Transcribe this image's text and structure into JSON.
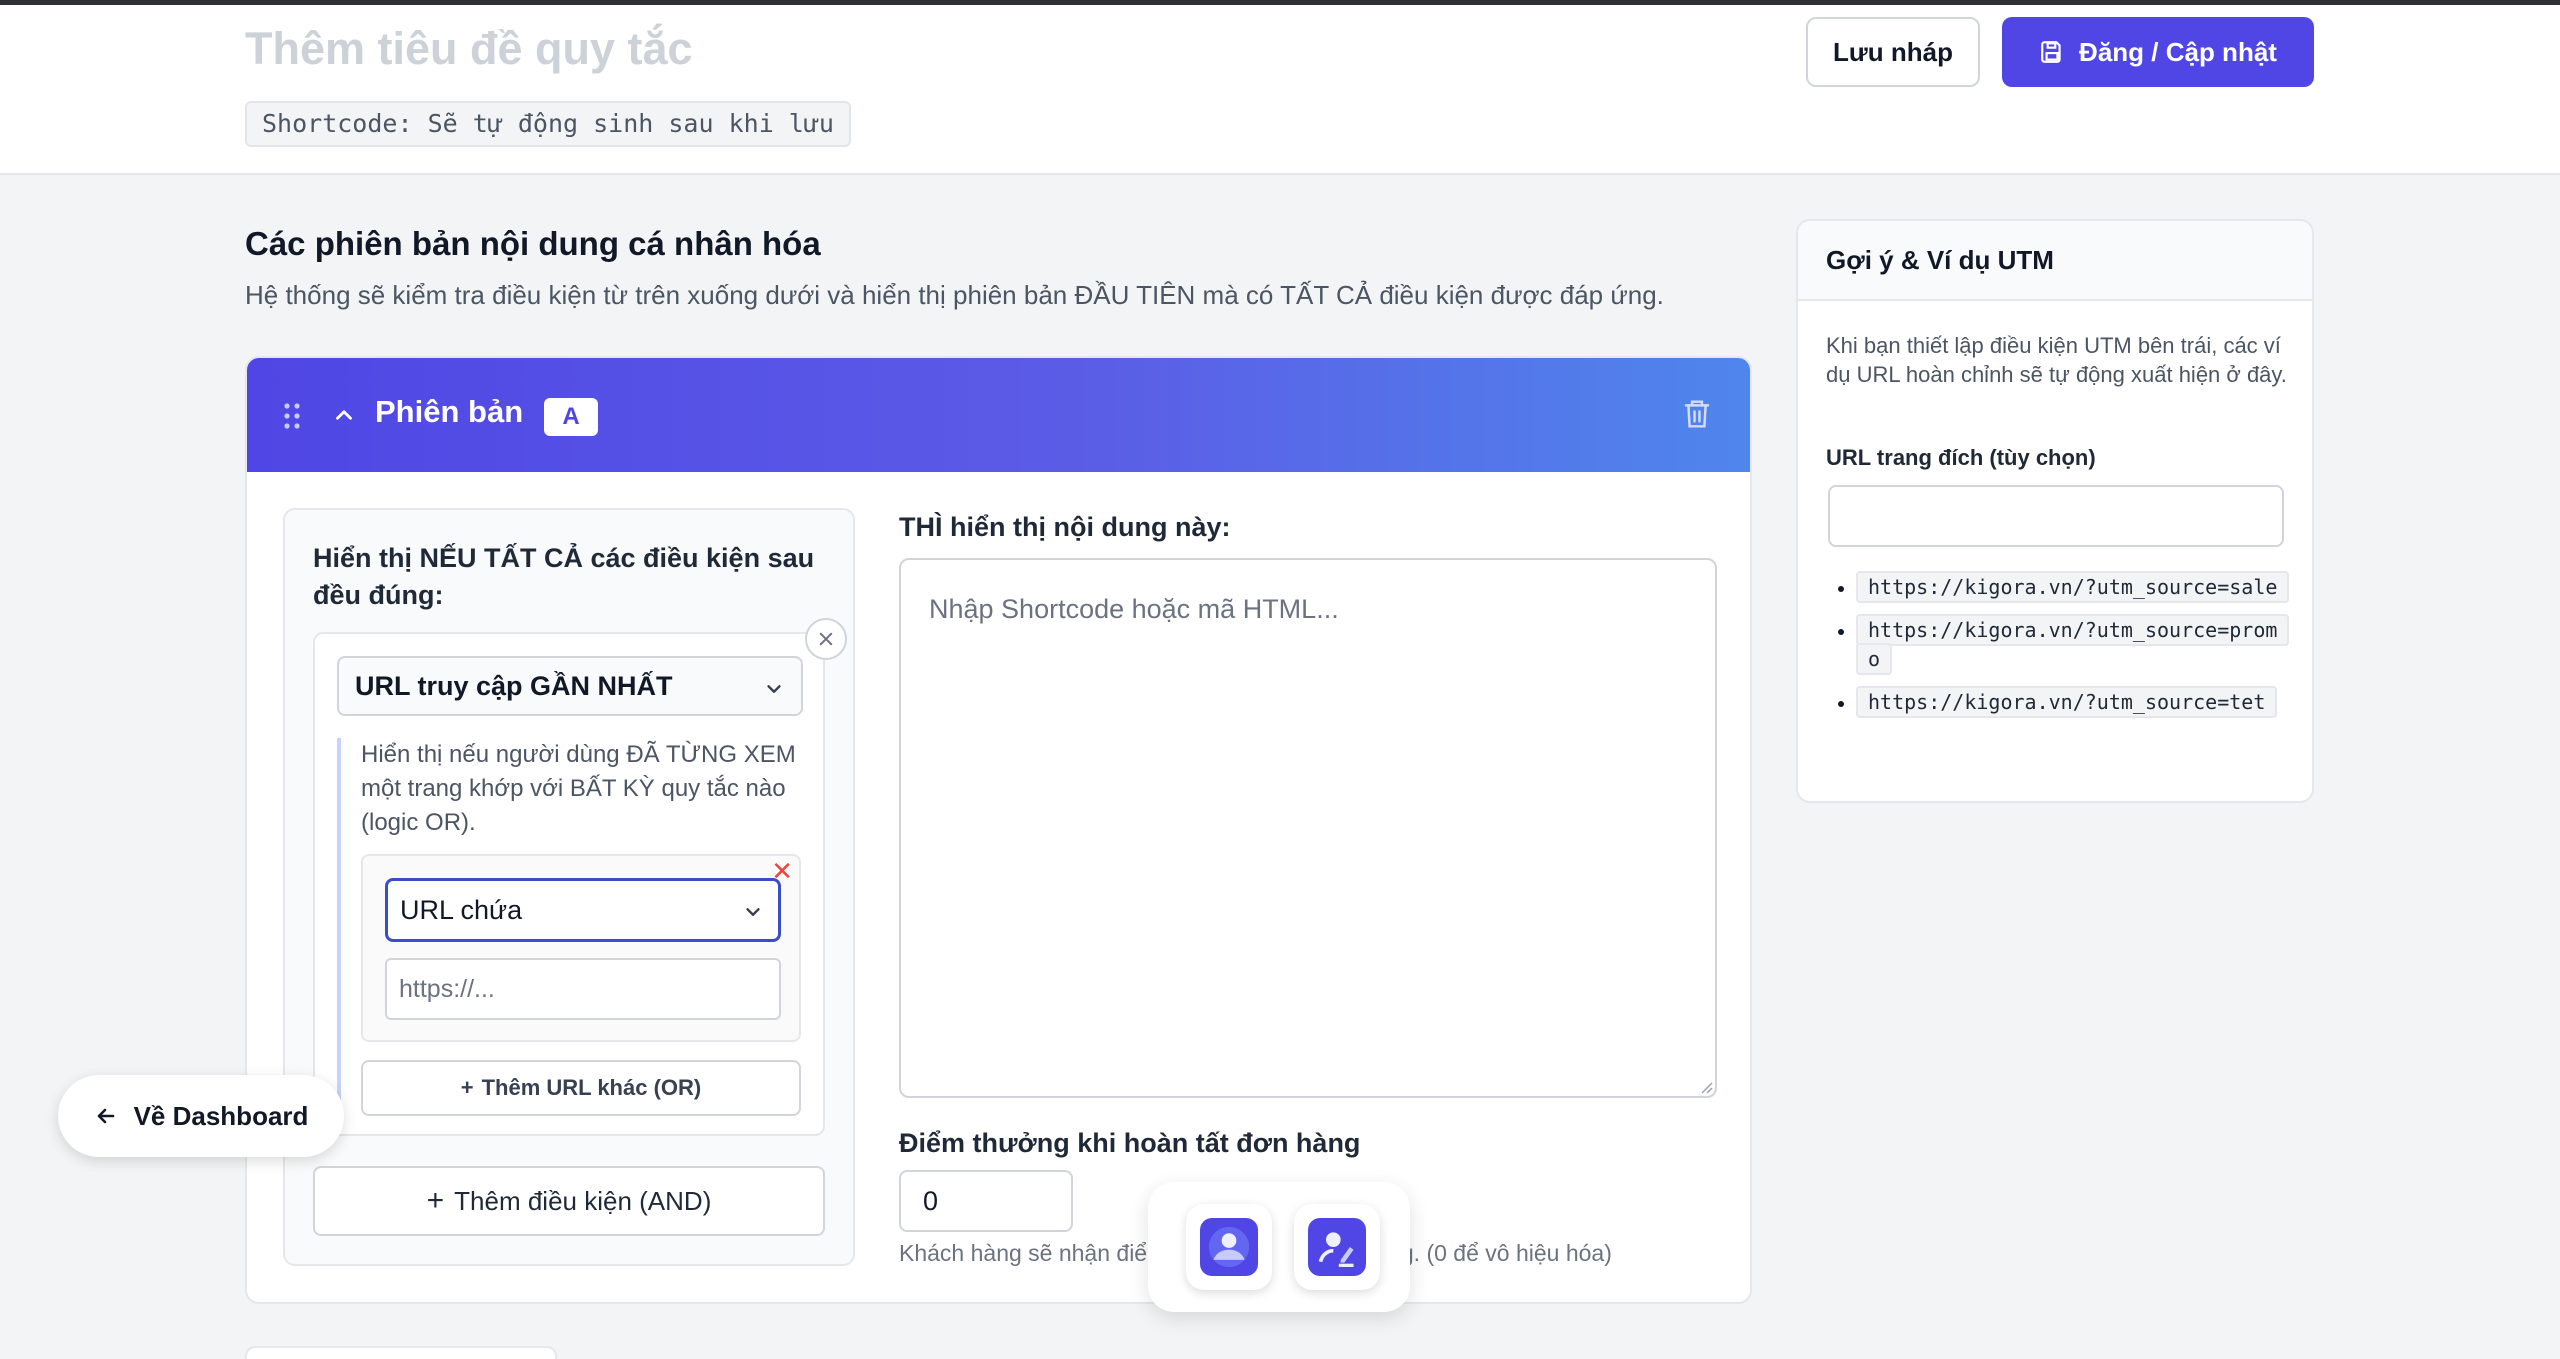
{
  "header": {
    "title_placeholder": "Thêm tiêu đề quy tắc",
    "shortcode": "Shortcode: Sẽ tự động sinh sau khi lưu",
    "save_draft_label": "Lưu nháp",
    "publish_label": "Đăng / Cập nhật"
  },
  "section": {
    "title": "Các phiên bản nội dung cá nhân hóa",
    "description": "Hệ thống sẽ kiểm tra điều kiện từ trên xuống dưới và hiển thị phiên bản ĐẦU TIÊN mà có TẤT CẢ điều kiện được đáp ứng."
  },
  "version": {
    "label": "Phiên bản",
    "badge": "A",
    "conditions": {
      "title": "Hiển thị NẾU TẤT CẢ các điều kiện sau đều đúng:",
      "condition_type": "URL truy cập GẦN NHẤT",
      "help": "Hiển thị nếu người dùng ĐÃ TỪNG XEM một trang khớp với BẤT KỲ quy tắc nào (logic OR).",
      "rule_operator": "URL chứa",
      "rule_placeholder": "https://...",
      "add_or_label": "Thêm URL khác (OR)",
      "add_and_label": "Thêm điều kiện (AND)"
    },
    "content": {
      "label": "THÌ hiển thị nội dung này:",
      "placeholder": "Nhập Shortcode hoặc mã HTML..."
    },
    "points": {
      "label": "Điểm thưởng khi hoàn tất đơn hàng",
      "value": "0",
      "help_left": "Khách hàng sẽ nhận điểm",
      "help_right": "ành công. (0 để vô hiệu hóa)"
    }
  },
  "utm": {
    "title": "Gợi ý & Ví dụ UTM",
    "intro": "Khi bạn thiết lập điều kiện UTM bên trái, các ví dụ URL hoàn chỉnh sẽ tự động xuất hiện ở đây.",
    "landing_label": "URL trang đích (tùy chọn)",
    "landing_value": "",
    "examples": [
      "https://kigora.vn/?utm_source=sale",
      "https://kigora.vn/?utm_source=promo",
      "https://kigora.vn/?utm_source=tet"
    ]
  },
  "dashboard_button": "Về Dashboard",
  "dock": {
    "icons": [
      "user-profile-icon",
      "ai-assistant-icon"
    ]
  },
  "colors": {
    "primary": "#4f46e5",
    "gradient_end": "#4f86ec",
    "danger": "#ef4444"
  }
}
